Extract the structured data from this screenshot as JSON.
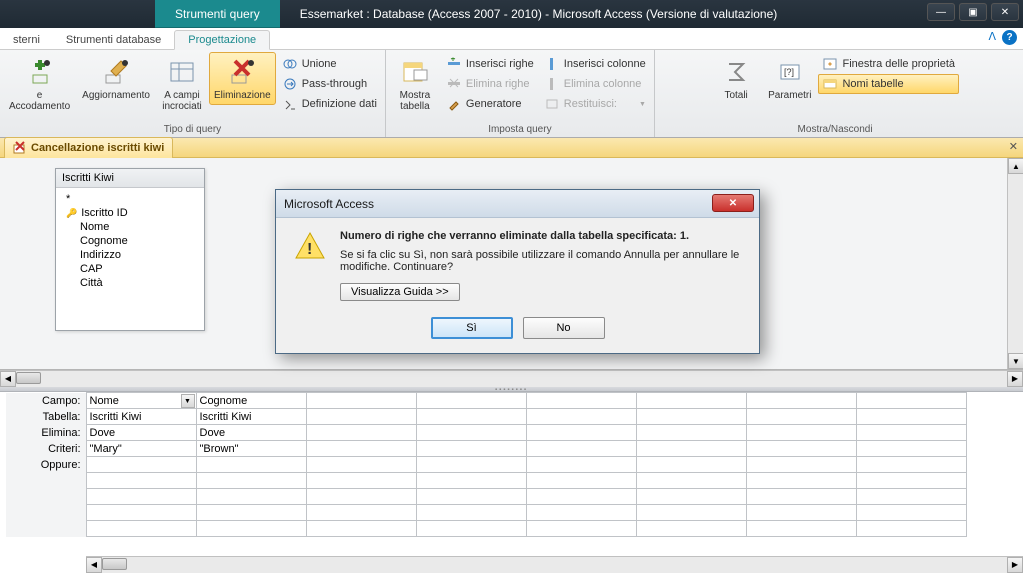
{
  "titlebar": {
    "context_tab": "Strumenti query",
    "title": "Essemarket : Database (Access 2007 - 2010)  -  Microsoft Access (Versione di valutazione)"
  },
  "ribbon_tabs": {
    "t1": "sterni",
    "t2": "Strumenti database",
    "t3": "Progettazione"
  },
  "ribbon": {
    "group1_label": "Tipo di query",
    "group2_label": "Imposta query",
    "group3_label": "Mostra/Nascondi",
    "btn_accod_top": "e",
    "btn_accod": "Accodamento",
    "btn_aggior": "Aggiornamento",
    "btn_campi_top": "A campi",
    "btn_campi_bot": "incrociati",
    "btn_elim": "Eliminazione",
    "btn_unione": "Unione",
    "btn_pass": "Pass-through",
    "btn_defdat": "Definizione dati",
    "btn_mostra_top": "Mostra",
    "btn_mostra_bot": "tabella",
    "btn_ins_righe": "Inserisci righe",
    "btn_elim_righe": "Elimina righe",
    "btn_gen": "Generatore",
    "btn_ins_col": "Inserisci colonne",
    "btn_elim_col": "Elimina colonne",
    "btn_rest": "Restituisci:",
    "btn_totali": "Totali",
    "btn_param": "Parametri",
    "btn_prop": "Finestra delle proprietà",
    "btn_nomi": "Nomi tabelle"
  },
  "qbe": {
    "tab_title": "Cancellazione iscritti kiwi"
  },
  "table_box": {
    "title": "Iscritti Kiwi",
    "star": "*",
    "f1": "Iscritto ID",
    "f2": "Nome",
    "f3": "Cognome",
    "f4": "Indirizzo",
    "f5": "CAP",
    "f6": "Città"
  },
  "grid": {
    "r_campo": "Campo:",
    "r_tabella": "Tabella:",
    "r_elimina": "Elimina:",
    "r_criteri": "Criteri:",
    "r_oppure": "Oppure:",
    "c1": {
      "campo": "Nome",
      "tabella": "Iscritti Kiwi",
      "elimina": "Dove",
      "criteri": "\"Mary\""
    },
    "c2": {
      "campo": "Cognome",
      "tabella": "Iscritti Kiwi",
      "elimina": "Dove",
      "criteri": "\"Brown\""
    }
  },
  "dialog": {
    "title": "Microsoft Access",
    "heading": "Numero di righe che verranno eliminate dalla tabella specificata: 1.",
    "body": "Se si fa clic su Sì, non sarà possibile utilizzare il comando Annulla per annullare le modifiche. Continuare?",
    "guide_btn": "Visualizza Guida >>",
    "yes": "Sì",
    "no": "No"
  }
}
